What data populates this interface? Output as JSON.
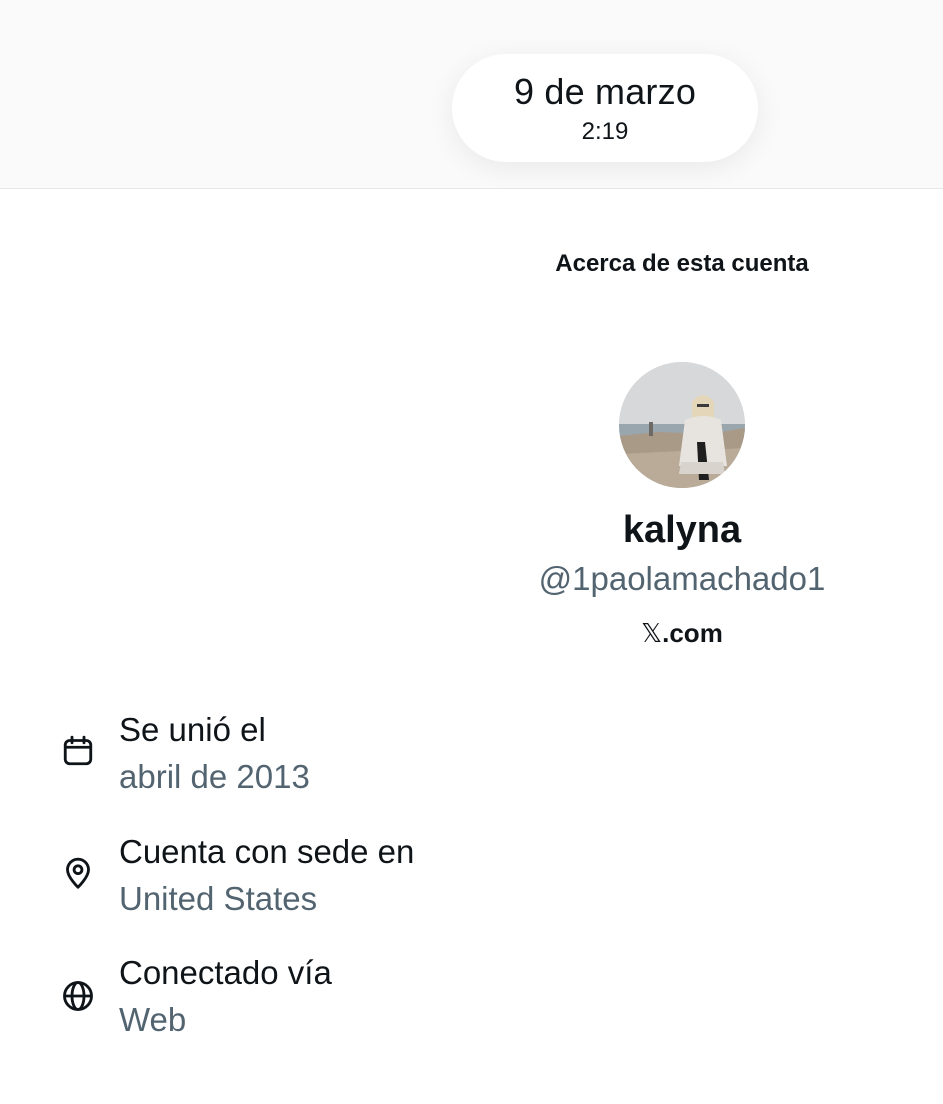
{
  "header": {
    "date": "9 de marzo",
    "time": "2:19"
  },
  "about": {
    "title": "Acerca de esta cuenta",
    "display_name": "kalyna",
    "handle": "@1paolamachado1",
    "site_logo": "𝕏",
    "site_suffix": ".com"
  },
  "details": [
    {
      "icon": "calendar-icon",
      "label": "Se unió el",
      "value": "abril de 2013"
    },
    {
      "icon": "location-pin-icon",
      "label": "Cuenta con sede en",
      "value": "United States"
    },
    {
      "icon": "globe-icon",
      "label": "Conectado vía",
      "value": "Web"
    }
  ],
  "colors": {
    "primary_text": "#0f1419",
    "secondary_text": "#536471",
    "background": "#ffffff",
    "top_band": "#fafafa"
  }
}
